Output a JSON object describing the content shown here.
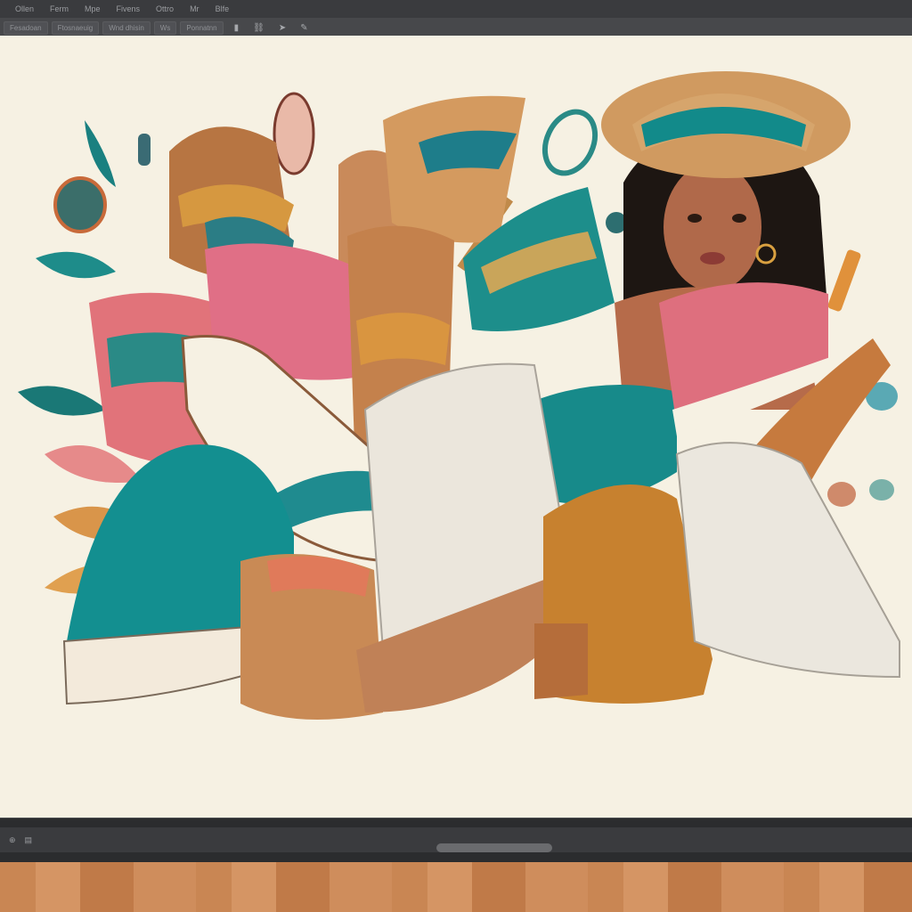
{
  "menubar": {
    "items": [
      "Ollen",
      "Ferm",
      "Mpe",
      "Fivens",
      "Ottro",
      "Mr",
      "Blfe"
    ]
  },
  "optionsbar": {
    "buttons": [
      "Fesadoan",
      "Ftosnaeuig",
      "Wnd dhisin",
      "Ws"
    ],
    "extra": "Ponnatnn"
  },
  "colors": {
    "chrome_dark": "#2c2d2f",
    "chrome_mid": "#47484b",
    "artboard": "#f6f1e3",
    "teal": "#1a8f8f",
    "tan": "#c98a55",
    "pink": "#e07a8f",
    "orange": "#d99540"
  },
  "icons": {
    "menubar": "app-menu",
    "tools": [
      "text-tool-icon",
      "link-icon",
      "arrow-icon",
      "pencil-icon"
    ],
    "status": [
      "zoom-icon",
      "page-icon"
    ]
  }
}
